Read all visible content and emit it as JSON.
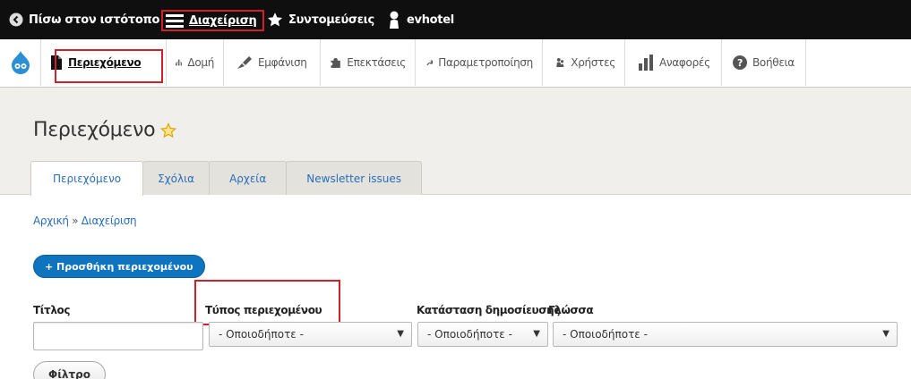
{
  "toolbar": {
    "back_label": "Πίσω στον ιστότοπο",
    "manage_label": "Διαχείριση",
    "shortcuts_label": "Συντομεύσεις",
    "user_label": "evhotel"
  },
  "tray": {
    "items": [
      {
        "label": "Περιεχόμενο",
        "icon": "file-icon"
      },
      {
        "label": "Δομή",
        "icon": "sitemap-icon"
      },
      {
        "label": "Εμφάνιση",
        "icon": "paintbrush-icon"
      },
      {
        "label": "Επεκτάσεις",
        "icon": "puzzle-icon"
      },
      {
        "label": "Παραμετροποίηση",
        "icon": "wrench-icon"
      },
      {
        "label": "Χρήστες",
        "icon": "people-icon"
      },
      {
        "label": "Αναφορές",
        "icon": "bar-chart-icon"
      },
      {
        "label": "Βοήθεια",
        "icon": "help-icon"
      }
    ]
  },
  "page": {
    "title": "Περιεχόμενο"
  },
  "tabs": [
    "Περιεχόμενο",
    "Σχόλια",
    "Αρχεία",
    "Newsletter issues"
  ],
  "breadcrumb": {
    "home": "Αρχική",
    "separator": "»",
    "current": "Διαχείριση"
  },
  "add_button": "+ Προσθήκη περιεχομένου",
  "filters": {
    "title_label": "Τίτλος",
    "type_label": "Τύπος περιεχομένου",
    "status_label": "Κατάσταση δημοσίευσης",
    "language_label": "Γλώσσα",
    "type_value": "- Οποιοδήποτε -",
    "status_value": "- Οποιοδήποτε -",
    "language_value": "- Οποιοδήποτε -",
    "filter_button": "Φίλτρο"
  },
  "colors": {
    "toolbar_bg": "#0f0f0f",
    "highlight_red": "#d0202a",
    "link_blue": "#2a6ebb",
    "button_blue": "#0f74bf",
    "header_bg": "#f0efeb"
  }
}
